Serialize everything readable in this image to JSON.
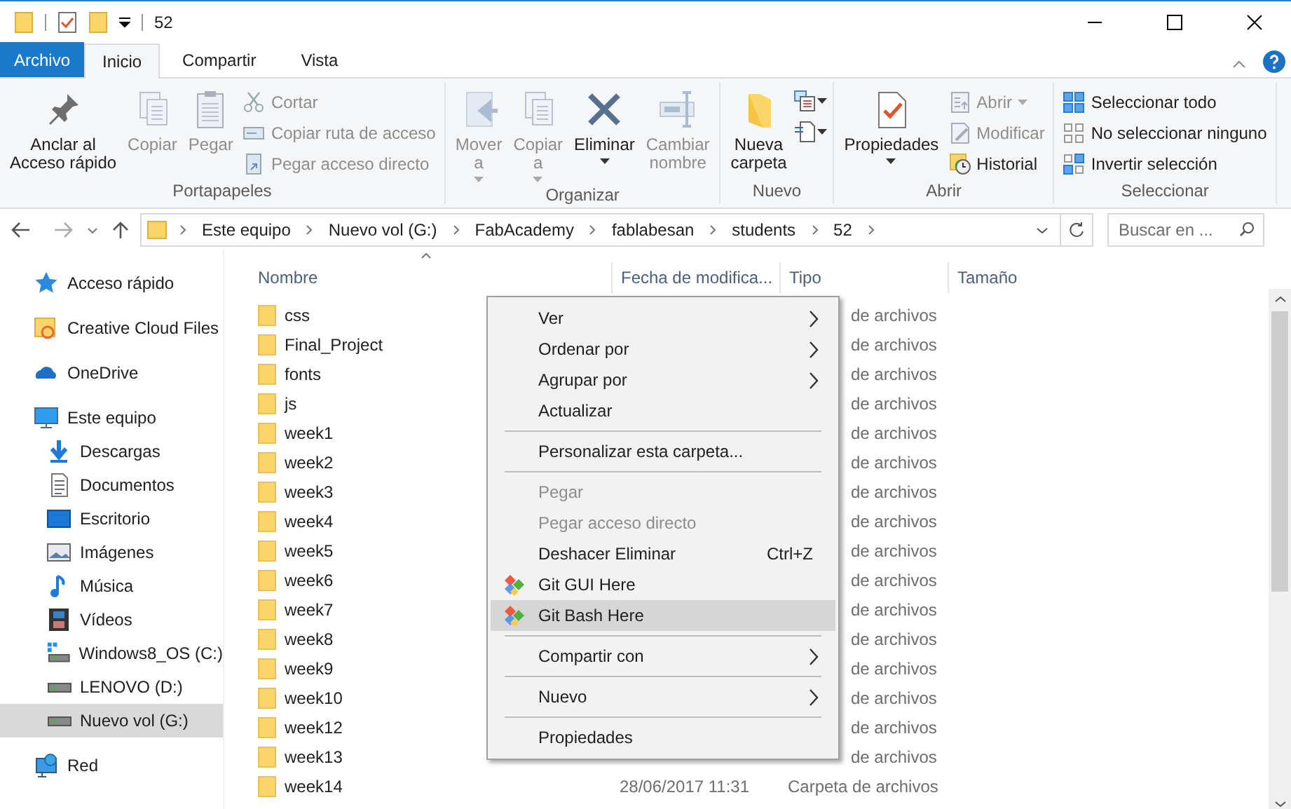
{
  "title_bar": {
    "title": "52"
  },
  "ribbon_tabs": [
    {
      "label": "Archivo",
      "kind": "file",
      "selected": false
    },
    {
      "label": "Inicio",
      "kind": "tab",
      "selected": true
    },
    {
      "label": "Compartir",
      "kind": "tab",
      "selected": false
    },
    {
      "label": "Vista",
      "kind": "tab",
      "selected": false
    }
  ],
  "ribbon_groups": [
    {
      "label": "Portapapeles",
      "items": [
        {
          "label": "Anclar al\nAcceso rápido",
          "kind": "large",
          "disabled": false
        },
        {
          "label": "Copiar",
          "kind": "large",
          "disabled": true
        },
        {
          "label": "Pegar",
          "kind": "large",
          "disabled": true
        },
        {
          "kind": "stack",
          "items": [
            {
              "label": "Cortar",
              "disabled": true
            },
            {
              "label": "Copiar ruta de acceso",
              "disabled": true
            },
            {
              "label": "Pegar acceso directo",
              "disabled": true
            }
          ]
        }
      ]
    },
    {
      "label": "Organizar",
      "items": [
        {
          "label": "Mover\na",
          "kind": "large",
          "disabled": true,
          "dropdown": true
        },
        {
          "label": "Copiar\na",
          "kind": "large",
          "disabled": true,
          "dropdown": true
        },
        {
          "label": "Eliminar",
          "kind": "large",
          "disabled": false,
          "dropdown": true
        },
        {
          "label": "Cambiar\nnombre",
          "kind": "large",
          "disabled": true,
          "dropdown": false
        }
      ]
    },
    {
      "label": "Nuevo",
      "items": [
        {
          "label": "Nueva\ncarpeta",
          "kind": "large",
          "disabled": false
        },
        {
          "kind": "minis"
        }
      ]
    },
    {
      "label": "Abrir",
      "items": [
        {
          "label": "Propiedades",
          "kind": "large",
          "disabled": false,
          "dropdown": true
        },
        {
          "kind": "stack",
          "items": [
            {
              "label": "Abrir",
              "disabled": true,
              "dropdown": true
            },
            {
              "label": "Modificar",
              "disabled": true,
              "dropdown": false
            },
            {
              "label": "Historial",
              "disabled": false,
              "dropdown": false
            }
          ]
        }
      ]
    },
    {
      "label": "Seleccionar",
      "items": [
        {
          "kind": "stack",
          "items": [
            {
              "label": "Seleccionar todo",
              "disabled": false
            },
            {
              "label": "No seleccionar ninguno",
              "disabled": false
            },
            {
              "label": "Invertir selección",
              "disabled": false
            }
          ]
        }
      ]
    }
  ],
  "address_bar": {
    "path": [
      "Este equipo",
      "Nuevo vol (G:)",
      "FabAcademy",
      "fablabesan",
      "students",
      "52"
    ]
  },
  "search": {
    "placeholder": "Buscar en ..."
  },
  "navigation": [
    {
      "label": "Acceso rápido",
      "selected": false
    },
    {
      "label": "Creative Cloud Files",
      "selected": false
    },
    {
      "label": "OneDrive",
      "selected": false
    },
    {
      "label": "Este equipo",
      "selected": false,
      "children": [
        {
          "label": "Descargas",
          "selected": false
        },
        {
          "label": "Documentos",
          "selected": false
        },
        {
          "label": "Escritorio",
          "selected": false
        },
        {
          "label": "Imágenes",
          "selected": false
        },
        {
          "label": "Música",
          "selected": false
        },
        {
          "label": "Vídeos",
          "selected": false
        },
        {
          "label": "Windows8_OS (C:)",
          "selected": false
        },
        {
          "label": "LENOVO (D:)",
          "selected": false
        },
        {
          "label": "Nuevo vol (G:)",
          "selected": true
        }
      ]
    },
    {
      "label": "Red",
      "selected": false
    }
  ],
  "file_list": {
    "columns": [
      "Nombre",
      "Fecha de modifica...",
      "Tipo",
      "Tamaño"
    ],
    "rows": [
      {
        "name": "css",
        "type": "de archivos",
        "type_cut": true
      },
      {
        "name": "Final_Project",
        "type": "de archivos",
        "type_cut": true
      },
      {
        "name": "fonts",
        "type": "de archivos",
        "type_cut": true
      },
      {
        "name": "js",
        "type": "de archivos",
        "type_cut": true
      },
      {
        "name": "week1",
        "type": "de archivos",
        "type_cut": true
      },
      {
        "name": "week2",
        "type": "de archivos",
        "type_cut": true
      },
      {
        "name": "week3",
        "type": "de archivos",
        "type_cut": true
      },
      {
        "name": "week4",
        "type": "de archivos",
        "type_cut": true
      },
      {
        "name": "week5",
        "type": "de archivos",
        "type_cut": true
      },
      {
        "name": "week6",
        "type": "de archivos",
        "type_cut": true
      },
      {
        "name": "week7",
        "type": "de archivos",
        "type_cut": true
      },
      {
        "name": "week8",
        "type": "de archivos",
        "type_cut": true
      },
      {
        "name": "week9",
        "type": "de archivos",
        "type_cut": true
      },
      {
        "name": "week10",
        "type": "de archivos",
        "type_cut": true
      },
      {
        "name": "week12",
        "type": "de archivos",
        "type_cut": true
      },
      {
        "name": "week13",
        "type": "de archivos",
        "type_cut": true
      },
      {
        "name": "week14",
        "date": "28/06/2017 11:31",
        "type": "Carpeta de archivos"
      }
    ]
  },
  "context_menu": [
    {
      "kind": "item",
      "label": "Ver",
      "submenu": true,
      "disabled": false,
      "selected": false
    },
    {
      "kind": "item",
      "label": "Ordenar por",
      "submenu": true,
      "disabled": false,
      "selected": false
    },
    {
      "kind": "item",
      "label": "Agrupar por",
      "submenu": true,
      "disabled": false,
      "selected": false
    },
    {
      "kind": "item",
      "label": "Actualizar",
      "submenu": false,
      "disabled": false,
      "selected": false
    },
    {
      "kind": "separator"
    },
    {
      "kind": "item",
      "label": "Personalizar esta carpeta...",
      "submenu": false,
      "disabled": false,
      "selected": false
    },
    {
      "kind": "separator"
    },
    {
      "kind": "item",
      "label": "Pegar",
      "submenu": false,
      "disabled": true,
      "selected": false
    },
    {
      "kind": "item",
      "label": "Pegar acceso directo",
      "submenu": false,
      "disabled": true,
      "selected": false
    },
    {
      "kind": "item",
      "label": "Deshacer Eliminar",
      "shortcut": "Ctrl+Z",
      "submenu": false,
      "disabled": false,
      "selected": false
    },
    {
      "kind": "iconitem",
      "label": "Git GUI Here",
      "submenu": false,
      "disabled": false,
      "selected": false
    },
    {
      "kind": "iconitem",
      "label": "Git Bash Here",
      "submenu": false,
      "disabled": false,
      "selected": true
    },
    {
      "kind": "separator"
    },
    {
      "kind": "item",
      "label": "Compartir con",
      "submenu": true,
      "disabled": false,
      "selected": false
    },
    {
      "kind": "separator"
    },
    {
      "kind": "item",
      "label": "Nuevo",
      "submenu": true,
      "disabled": false,
      "selected": false
    },
    {
      "kind": "separator"
    },
    {
      "kind": "item",
      "label": "Propiedades",
      "submenu": false,
      "disabled": false,
      "selected": false
    }
  ]
}
